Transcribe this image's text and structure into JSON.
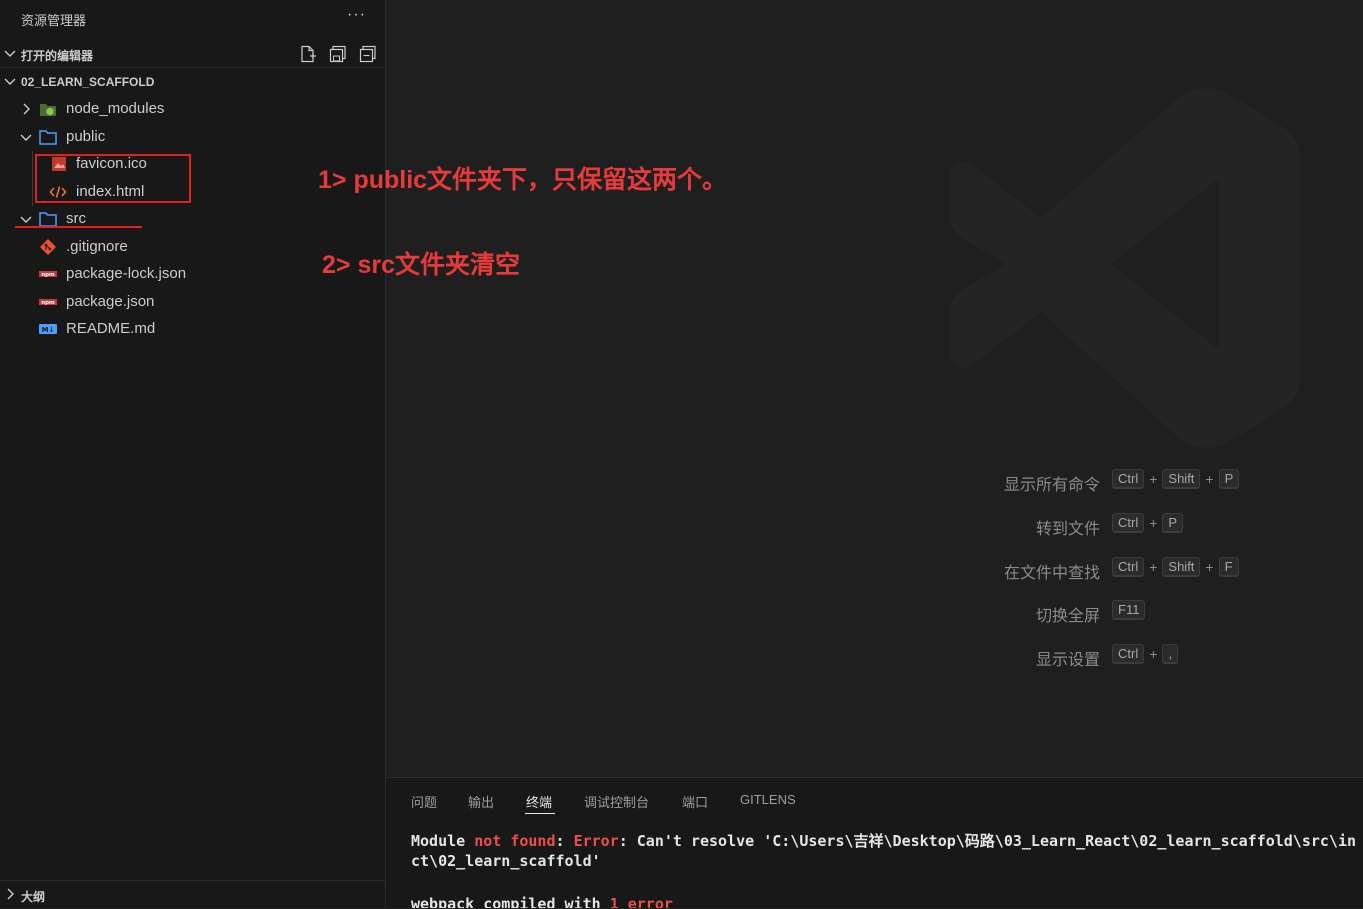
{
  "sidebar": {
    "title": "资源管理器",
    "more_label": "···",
    "open_editors_label": "打开的编辑器",
    "project_label": "02_LEARN_SCAFFOLD",
    "outline_label": "大纲",
    "tree": [
      {
        "name": "node_modules",
        "icon": "node-modules-icon"
      },
      {
        "name": "public",
        "icon": "folder-icon"
      },
      {
        "name": "favicon.ico",
        "icon": "image-file-icon"
      },
      {
        "name": "index.html",
        "icon": "html-file-icon"
      },
      {
        "name": "src",
        "icon": "folder-icon"
      },
      {
        "name": ".gitignore",
        "icon": "git-icon"
      },
      {
        "name": "package-lock.json",
        "icon": "npm-icon"
      },
      {
        "name": "package.json",
        "icon": "npm-icon"
      },
      {
        "name": "README.md",
        "icon": "markdown-icon"
      }
    ]
  },
  "annotations": {
    "note1": "1> public文件夹下，只保留这两个。",
    "note2": "2> src文件夹清空"
  },
  "editor_hints": [
    {
      "label": "显示所有命令",
      "keys": [
        "Ctrl",
        "Shift",
        "P"
      ]
    },
    {
      "label": "转到文件",
      "keys": [
        "Ctrl",
        "P"
      ]
    },
    {
      "label": "在文件中查找",
      "keys": [
        "Ctrl",
        "Shift",
        "F"
      ]
    },
    {
      "label": "切换全屏",
      "keys": [
        "F11"
      ]
    },
    {
      "label": "显示设置",
      "keys": [
        "Ctrl",
        ","
      ]
    }
  ],
  "panel": {
    "tabs": [
      "问题",
      "输出",
      "终端",
      "调试控制台",
      "端口",
      "GITLENS"
    ],
    "active_tab": "终端",
    "terminal": {
      "line1": {
        "p1": "Module ",
        "p2": "not found",
        "p3": ": ",
        "p4": "Error",
        "p5": ": Can't resolve 'C:\\Users\\吉祥\\Desktop\\码路\\03_Learn_React\\02_learn_scaffold\\src\\in"
      },
      "line2": "ct\\02_learn_scaffold'",
      "line3": {
        "p1": "webpack compiled with ",
        "p2": "1 error"
      }
    }
  },
  "colors": {
    "annotation_red": "#e02020",
    "accent": "#4a9eff"
  }
}
